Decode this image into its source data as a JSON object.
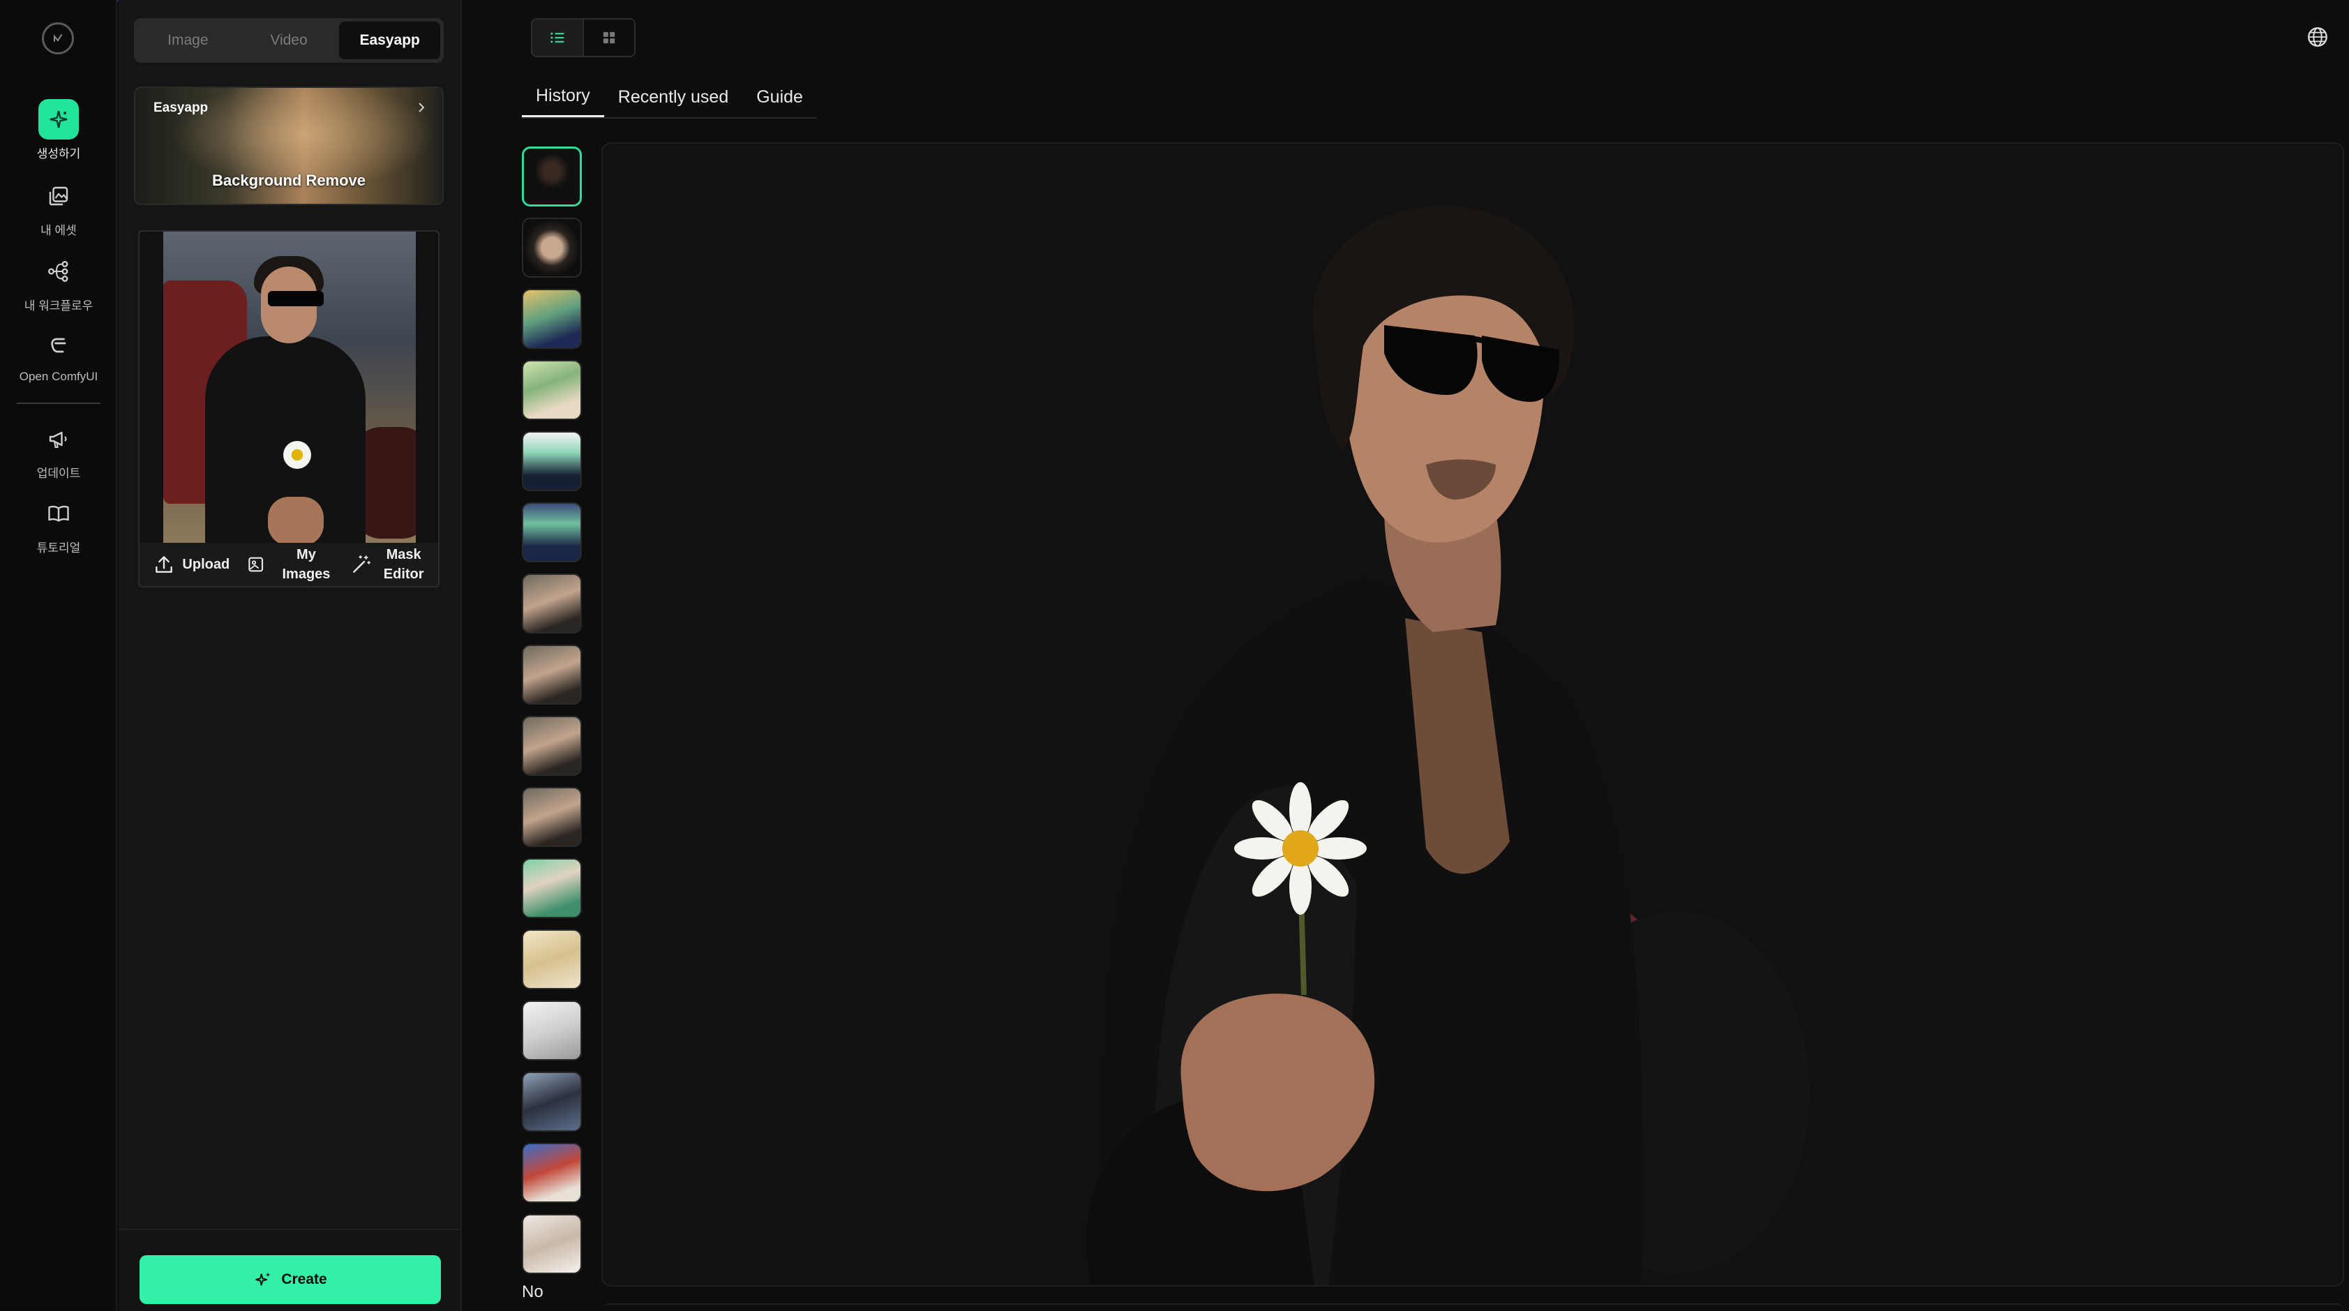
{
  "rail": {
    "items": [
      {
        "label": "생성하기",
        "icon": "sparkle-icon",
        "active": true
      },
      {
        "label": "내 에셋",
        "icon": "gallery-icon"
      },
      {
        "label": "내 워크플로우",
        "icon": "workflow-icon"
      },
      {
        "label": "Open ComfyUI",
        "icon": "comfyui-icon"
      },
      {
        "label": "업데이트",
        "icon": "megaphone-icon"
      },
      {
        "label": "튜토리얼",
        "icon": "book-icon"
      }
    ]
  },
  "panel": {
    "modes": [
      "Image",
      "Video",
      "Easyapp"
    ],
    "active_mode": "Easyapp",
    "app_card": {
      "tag": "Easyapp",
      "title": "Background Remove"
    },
    "upload_actions": {
      "upload": "Upload",
      "my_images": "My Images",
      "mask_editor": "Mask Editor"
    },
    "create_label": "Create"
  },
  "main": {
    "tabs": [
      "History",
      "Recently used",
      "Guide"
    ],
    "active_tab": "History",
    "thumbs_more": "No"
  },
  "colors": {
    "accent": "#34f0a6",
    "accent_dark": "#22e39a",
    "selected_border": "#2fdc9b",
    "background": "#0d0d0d"
  }
}
